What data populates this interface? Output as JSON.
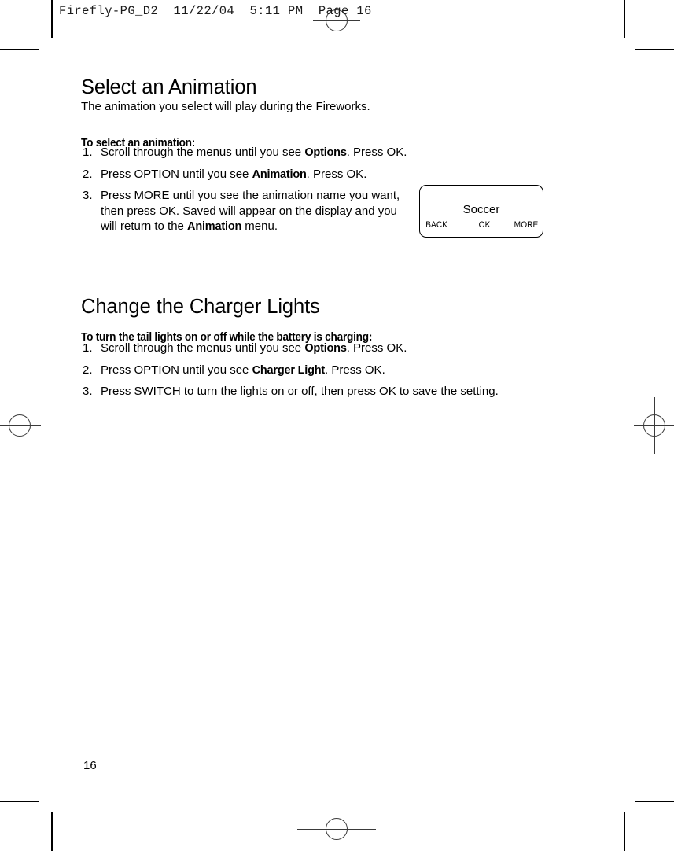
{
  "page": {
    "header_slug": "Firefly-PG_D2  11/22/04  5:11 PM  Page 16",
    "page_number": "16"
  },
  "section_one": {
    "title": "Select an Animation",
    "subtitle": "The animation you select will play during the Fireworks.",
    "lead": "To select an animation:",
    "steps": [
      {
        "num": "1.",
        "part1": "Scroll through the menus until you see ",
        "bold1": "Options",
        "part2": ". Press OK.",
        "bold2": "",
        "part3": ""
      },
      {
        "num": "2.",
        "part1": "Press OPTION until you see ",
        "bold1": "Animation",
        "part2": ". Press OK.",
        "bold2": "",
        "part3": ""
      },
      {
        "num": "3.",
        "part1": "Press MORE until you see the animation name you want, then press OK. Saved will appear on the display and you will return to the ",
        "bold1": "Animation",
        "part2": " menu.",
        "bold2": "",
        "part3": ""
      }
    ]
  },
  "section_two": {
    "title": "Change the Charger Lights",
    "lead": "To turn the tail lights on or off while the battery is charging:",
    "steps": [
      {
        "num": "1.",
        "part1": "Scroll through the menus until you see ",
        "bold1": "Options",
        "part2": ". Press OK."
      },
      {
        "num": "2.",
        "part1": "Press OPTION until you see ",
        "bold1": "Charger Light",
        "part2": ". Press OK."
      },
      {
        "num": "3.",
        "part1": "Press SWITCH to turn the lights on or off, then press OK to save the setting.",
        "bold1": "",
        "part2": ""
      }
    ]
  },
  "lcd_display": {
    "screen_text": "Soccer",
    "softkey_back": "BACK",
    "softkey_ok": "OK",
    "softkey_more": "MORE"
  }
}
